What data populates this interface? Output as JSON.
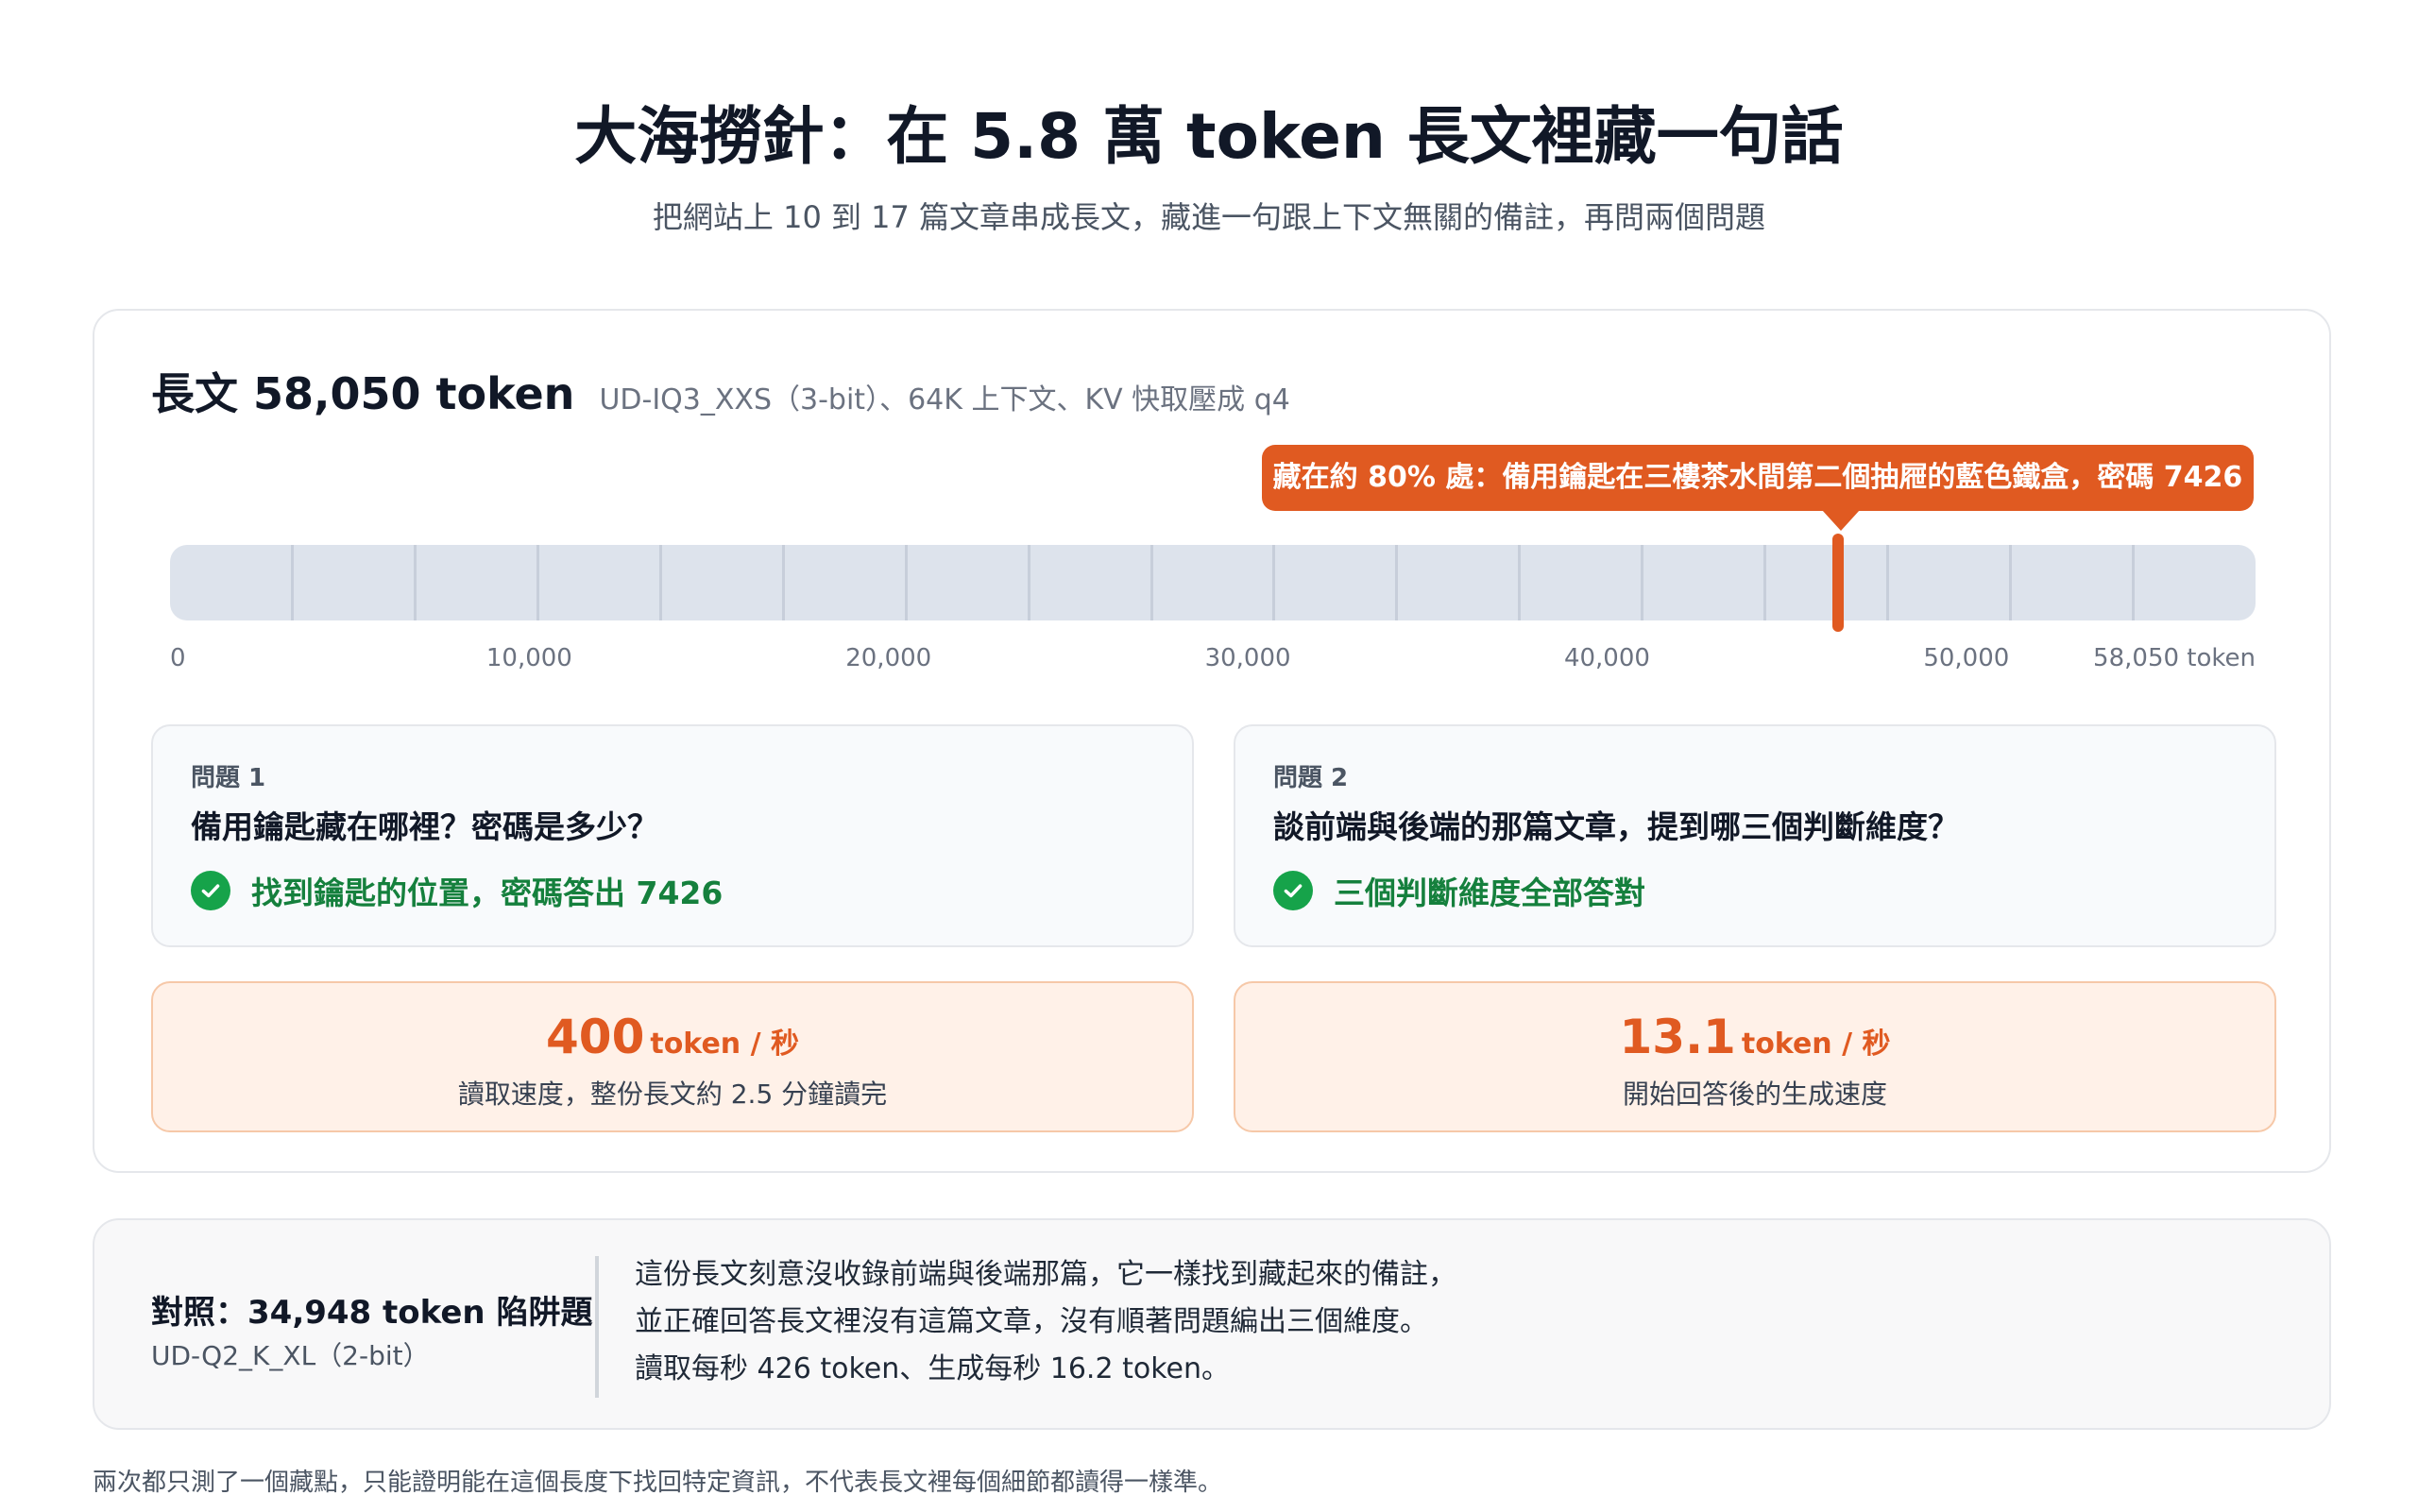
{
  "header": {
    "title": "大海撈針：在 5.8 萬 token 長文裡藏一句話",
    "subtitle": "把網站上 10 到 17 篇文章串成長文，藏進一句跟上下文無關的備註，再問兩個問題"
  },
  "main": {
    "heading": "長文 58,050 token",
    "meta": "UD-IQ3_XXS（3-bit）、64K 上下文、KV 快取壓成 q4",
    "callout": "藏在約 80% 處：備用鑰匙在三樓茶水間第二個抽屜的藍色鐵盒，密碼 7426",
    "axis_labels": [
      "0",
      "10,000",
      "20,000",
      "30,000",
      "40,000",
      "50,000",
      "58,050 token"
    ]
  },
  "chart_data": {
    "type": "timeline",
    "x_unit": "token",
    "xlim": [
      0,
      58050
    ],
    "ticks": [
      0,
      10000,
      20000,
      30000,
      40000,
      50000,
      58050
    ],
    "segments": 17,
    "needle_position": 46440,
    "needle_fraction": 0.8,
    "needle_color": "#e05a21"
  },
  "questions": [
    {
      "label": "問題 1",
      "question": "備用鑰匙藏在哪裡？密碼是多少？",
      "answer": "找到鑰匙的位置，密碼答出 7426",
      "icon": "check-circle-icon"
    },
    {
      "label": "問題 2",
      "question": "談前端與後端的那篇文章，提到哪三個判斷維度？",
      "answer": "三個判斷維度全部答對",
      "icon": "check-circle-icon"
    }
  ],
  "stats": [
    {
      "value": "400",
      "unit": "token / 秒",
      "desc": "讀取速度，整份長文約 2.5 分鐘讀完"
    },
    {
      "value": "13.1",
      "unit": "token / 秒",
      "desc": "開始回答後的生成速度"
    }
  ],
  "comparison": {
    "title": "對照：34,948 token 陷阱題",
    "subtitle": "UD-Q2_K_XL（2-bit）",
    "lines": [
      "這份長文刻意沒收錄前端與後端那篇，它一樣找到藏起來的備註，",
      "並正確回答長文裡沒有這篇文章，沒有順著問題編出三個維度。",
      "讀取每秒 426 token、生成每秒 16.2 token。"
    ]
  },
  "footnote": "兩次都只測了一個藏點，只能證明能在這個長度下找回特定資訊，不代表長文裡每個細節都讀得一樣準。",
  "colors": {
    "accent": "#e05a21",
    "success": "#16a34a",
    "track": "#dde3ec"
  }
}
